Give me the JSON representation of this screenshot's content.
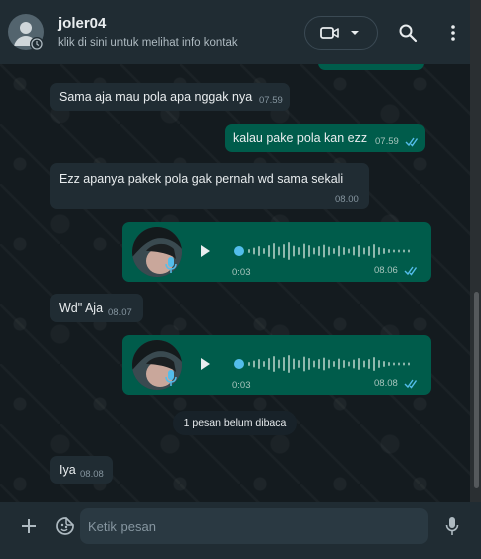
{
  "header": {
    "contact_name": "joler04",
    "contact_subtitle": "klik di sini untuk melihat info kontak"
  },
  "messages": [
    {
      "type": "text",
      "direction": "in",
      "text": "Sama aja mau pola apa nggak nya",
      "time": "07.59"
    },
    {
      "type": "text",
      "direction": "out",
      "text": "kalau pake pola kan ezz",
      "time": "07.59",
      "read": true
    },
    {
      "type": "text",
      "direction": "in",
      "text": "Ezz apanya pakek pola gak pernah wd sama sekali",
      "time": "08.00"
    },
    {
      "type": "voice",
      "direction": "out",
      "duration": "0:03",
      "time": "08.06",
      "read": true,
      "progress": 0.0
    },
    {
      "type": "text",
      "direction": "in",
      "text": "Wd\" Aja",
      "time": "08.07"
    },
    {
      "type": "voice",
      "direction": "out",
      "duration": "0:03",
      "time": "08.08",
      "read": true,
      "progress": 0.0
    },
    {
      "type": "text",
      "direction": "in",
      "text": "Iya",
      "time": "08.08"
    }
  ],
  "unread_divider": "1 pesan belum dibaca",
  "composer": {
    "placeholder": "Ketik pesan"
  },
  "icons": [
    "avatar-icon",
    "video-call-icon",
    "chevron-down-icon",
    "search-icon",
    "menu-icon",
    "play-icon",
    "mic-icon",
    "double-check-icon",
    "plus-icon",
    "sticker-icon"
  ],
  "colors": {
    "accent": "#53bdeb",
    "outgoing": "#005c4b",
    "incoming": "#202c33",
    "header": "#202c33"
  }
}
